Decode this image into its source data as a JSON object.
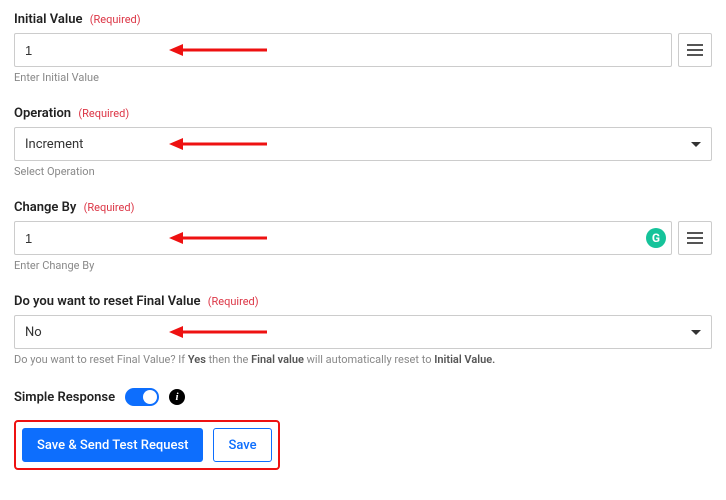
{
  "required_label": "(Required)",
  "fields": {
    "initial_value": {
      "label": "Initial Value",
      "value": "1",
      "helper": "Enter Initial Value"
    },
    "operation": {
      "label": "Operation",
      "value": "Increment",
      "helper": "Select Operation"
    },
    "change_by": {
      "label": "Change By",
      "value": "1",
      "helper": "Enter Change By"
    },
    "reset_final": {
      "label": "Do you want to reset Final Value",
      "value": "No",
      "helper_pre": "Do you want to reset Final Value? If ",
      "helper_yes": "Yes",
      "helper_mid": " then the ",
      "helper_final": "Final value",
      "helper_mid2": " will automatically reset to ",
      "helper_initial": "Initial Value."
    }
  },
  "simple_response": {
    "label": "Simple Response",
    "on": true
  },
  "buttons": {
    "primary": "Save & Send Test Request",
    "secondary": "Save"
  },
  "icons": {
    "grammarly": "G",
    "info": "i"
  },
  "colors": {
    "primary": "#0d6efd",
    "danger": "#dc3545",
    "highlight_border": "#e11",
    "grammarly": "#15c39a"
  }
}
